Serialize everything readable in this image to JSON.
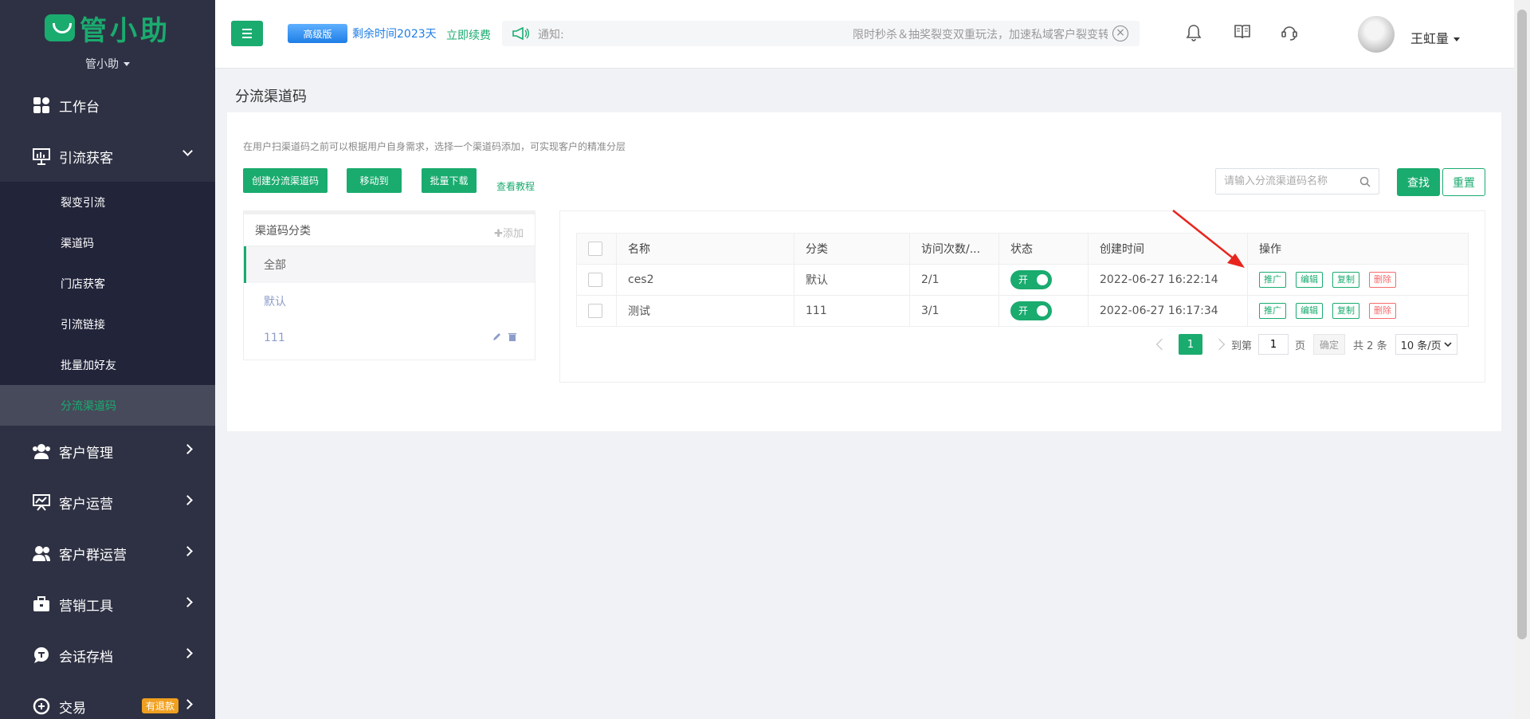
{
  "app": {
    "logo_text": "管小助",
    "account": "管小助"
  },
  "sidebar": {
    "items": [
      {
        "label": "工作台",
        "icon": "grid-icon"
      },
      {
        "label": "引流获客",
        "icon": "presentation-icon",
        "open": true
      },
      {
        "label": "客户管理",
        "icon": "users-icon"
      },
      {
        "label": "客户运营",
        "icon": "board-icon"
      },
      {
        "label": "客户群运营",
        "icon": "group-icon"
      },
      {
        "label": "营销工具",
        "icon": "briefcase-icon"
      },
      {
        "label": "会话存档",
        "icon": "chat-icon"
      },
      {
        "label": "交易",
        "icon": "trade-icon",
        "badge": "有退款"
      }
    ],
    "submenu": [
      "裂变引流",
      "渠道码",
      "门店获客",
      "引流链接",
      "批量加好友",
      "分流渠道码"
    ],
    "active_sub": "分流渠道码"
  },
  "header": {
    "version_badge": "高级版",
    "remaining": "剩余时间2023天",
    "renew": "立即续费",
    "notice_label": "通知:",
    "notice_text": "限时秒杀＆抽奖裂变双重玩法，加速私域客户裂变转化",
    "username": "王虹量"
  },
  "page": {
    "title": "分流渠道码",
    "tip": "在用户扫渠道码之前可以根据用户自身需求，选择一个渠道码添加，可实现客户的精准分层",
    "buttons": {
      "create": "创建分流渠道码",
      "move": "移动到",
      "download": "批量下载",
      "tutorial": "查看教程",
      "search": "查找",
      "reset": "重置"
    },
    "search_placeholder": "请输入分流渠道码名称"
  },
  "categories": {
    "header": "渠道码分类",
    "add": "✚添加",
    "items": [
      "全部",
      "默认",
      "111"
    ]
  },
  "table": {
    "columns": [
      "名称",
      "分类",
      "访问次数/...",
      "状态",
      "创建时间",
      "操作"
    ],
    "rows": [
      {
        "name": "ces2",
        "category": "默认",
        "visits": "2/1",
        "status": "开",
        "created": "2022-06-27 16:22:14"
      },
      {
        "name": "测试",
        "category": "111",
        "visits": "3/1",
        "status": "开",
        "created": "2022-06-27 16:17:34"
      }
    ],
    "actions": [
      "推广",
      "编辑",
      "复制",
      "删除"
    ]
  },
  "pagination": {
    "current": "1",
    "goto_label": "到第",
    "page_value": "1",
    "page_unit": "页",
    "confirm": "确定",
    "total": "共 2 条",
    "page_size": "10 条/页"
  },
  "colors": {
    "accent": "#1aab6f",
    "sidebar_bg": "#2e3143",
    "submenu_bg": "#22243a",
    "danger": "#f56c6c",
    "annotation_arrow": "#e8261e"
  }
}
